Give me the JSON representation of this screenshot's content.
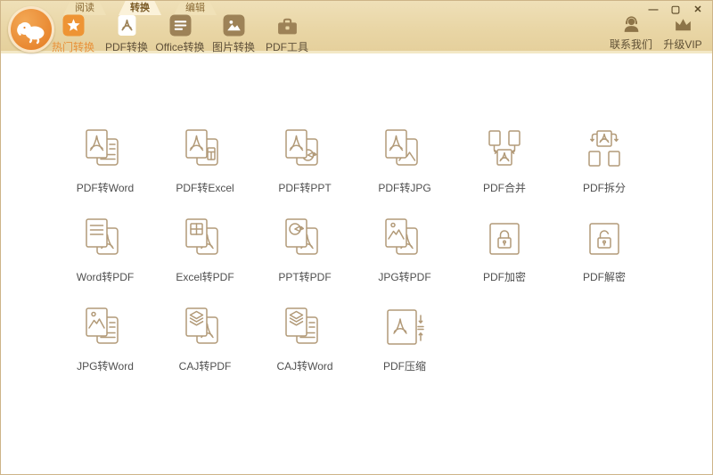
{
  "window": {
    "controls": [
      {
        "name": "minimize",
        "glyph": "—"
      },
      {
        "name": "maximize",
        "glyph": "▢"
      },
      {
        "name": "close",
        "glyph": "✕"
      }
    ]
  },
  "tabs": [
    {
      "label": "阅读",
      "active": false
    },
    {
      "label": "转换",
      "active": true
    },
    {
      "label": "编辑",
      "active": false
    }
  ],
  "toolbar": {
    "items": [
      {
        "label": "热门转换",
        "icon": "star-icon",
        "active": true
      },
      {
        "label": "PDF转换",
        "icon": "pdf-page-icon",
        "active": false
      },
      {
        "label": "Office转换",
        "icon": "office-doc-icon",
        "active": false
      },
      {
        "label": "图片转换",
        "icon": "image-icon",
        "active": false
      },
      {
        "label": "PDF工具",
        "icon": "toolbox-icon",
        "active": false
      }
    ],
    "right_items": [
      {
        "label": "联系我们",
        "icon": "headset-person-icon"
      },
      {
        "label": "升级VIP",
        "icon": "crown-icon"
      }
    ]
  },
  "grid": {
    "items": [
      {
        "label": "PDF转Word",
        "icon": "pdf-to-word-icon"
      },
      {
        "label": "PDF转Excel",
        "icon": "pdf-to-excel-icon"
      },
      {
        "label": "PDF转PPT",
        "icon": "pdf-to-ppt-icon"
      },
      {
        "label": "PDF转JPG",
        "icon": "pdf-to-jpg-icon"
      },
      {
        "label": "PDF合并",
        "icon": "pdf-merge-icon"
      },
      {
        "label": "PDF拆分",
        "icon": "pdf-split-icon"
      },
      {
        "label": "Word转PDF",
        "icon": "word-to-pdf-icon"
      },
      {
        "label": "Excel转PDF",
        "icon": "excel-to-pdf-icon"
      },
      {
        "label": "PPT转PDF",
        "icon": "ppt-to-pdf-icon"
      },
      {
        "label": "JPG转PDF",
        "icon": "jpg-to-pdf-icon"
      },
      {
        "label": "PDF加密",
        "icon": "pdf-lock-icon"
      },
      {
        "label": "PDF解密",
        "icon": "pdf-unlock-icon"
      },
      {
        "label": "JPG转Word",
        "icon": "jpg-to-word-icon"
      },
      {
        "label": "CAJ转PDF",
        "icon": "caj-to-pdf-icon"
      },
      {
        "label": "CAJ转Word",
        "icon": "caj-to-word-icon"
      },
      {
        "label": "PDF压缩",
        "icon": "pdf-compress-icon"
      }
    ]
  },
  "colors": {
    "accent_orange": "#ee9434",
    "header_tan": "#e9d6a6",
    "toolbar_icon_brown": "#9d8257",
    "line_icon_stroke": "#b29a78",
    "grid_label_text": "#4f4f4f"
  }
}
